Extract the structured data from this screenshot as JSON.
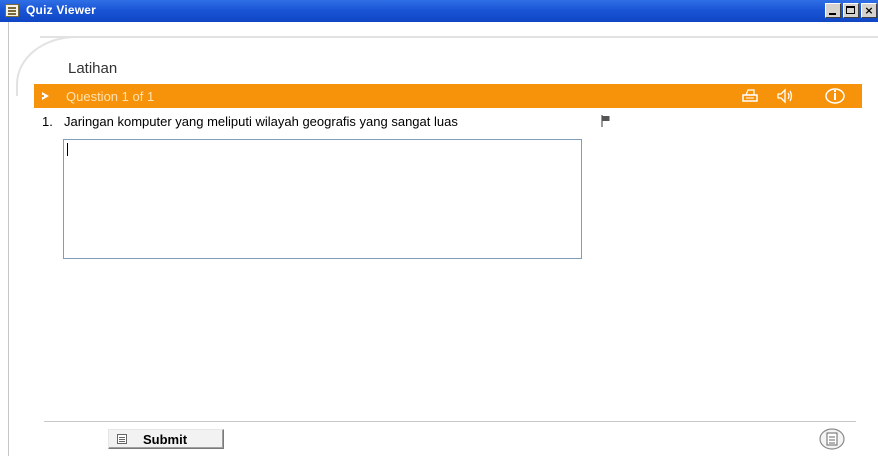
{
  "window": {
    "title": "Quiz Viewer",
    "minimize_glyph": "",
    "maximize_glyph": "",
    "close_glyph": "×"
  },
  "section": {
    "title": "Latihan"
  },
  "question_bar": {
    "label": "Question 1 of 1",
    "background_color": "#f7930a",
    "icons": [
      "print-icon",
      "audio-icon",
      "info-icon"
    ]
  },
  "question": {
    "number": "1.",
    "text": "Jaringan komputer yang meliputi wilayah geografis yang sangat luas",
    "flag_icon": "flag-icon"
  },
  "answer": {
    "value": ""
  },
  "footer": {
    "submit_label": "Submit",
    "notes_icon": "notes-icon"
  }
}
